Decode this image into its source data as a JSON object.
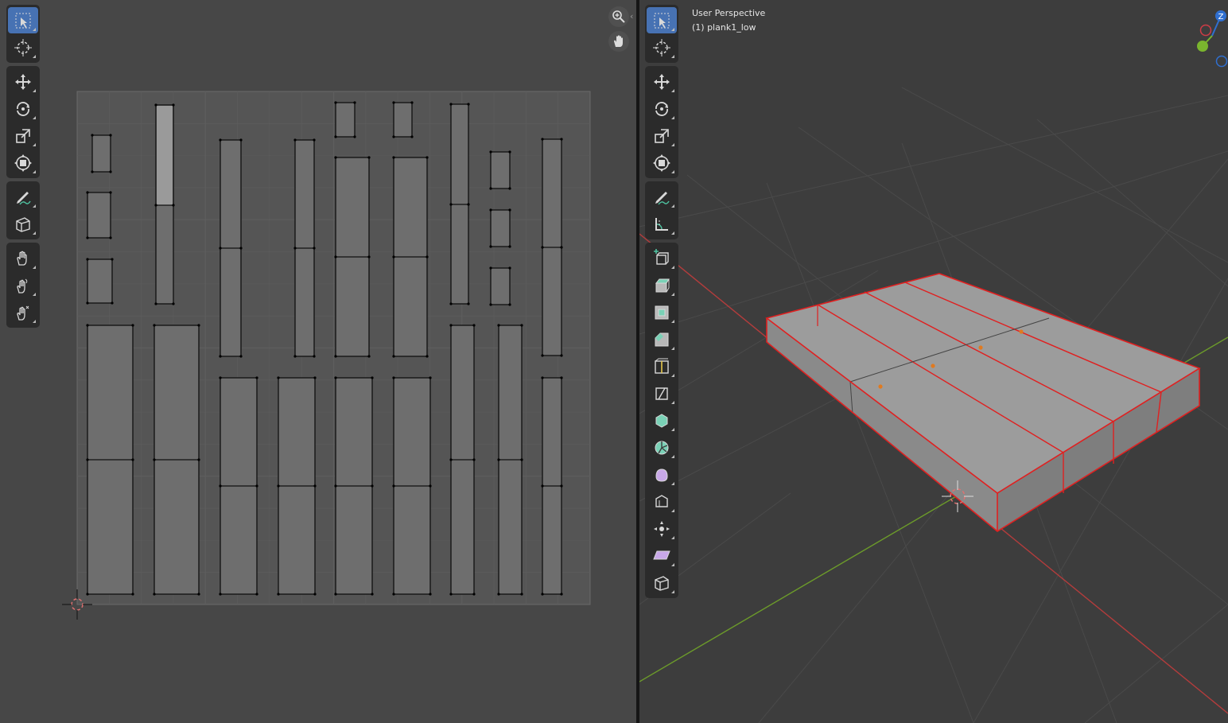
{
  "uv_editor": {
    "toolbar": [
      [
        {
          "name": "select-box-tool",
          "icon": "select-box-icon",
          "active": true
        },
        {
          "name": "cursor-tool",
          "icon": "cursor-icon",
          "active": false
        }
      ],
      [
        {
          "name": "move-tool",
          "icon": "move-icon",
          "active": false
        },
        {
          "name": "rotate-tool",
          "icon": "rotate-icon",
          "active": false
        },
        {
          "name": "scale-tool",
          "icon": "scale-icon",
          "active": false
        },
        {
          "name": "transform-tool",
          "icon": "transform-icon",
          "active": false
        }
      ],
      [
        {
          "name": "annotate-tool",
          "icon": "annotate-icon",
          "active": false
        },
        {
          "name": "rip-region-tool",
          "icon": "rip-region-icon",
          "active": false
        }
      ],
      [
        {
          "name": "grab-tool",
          "icon": "grab-hand-icon",
          "active": false
        },
        {
          "name": "relax-tool",
          "icon": "relax-icon",
          "active": false
        },
        {
          "name": "pinch-tool",
          "icon": "pinch-icon",
          "active": false
        }
      ]
    ],
    "nav_buttons": [
      {
        "name": "zoom-button",
        "icon": "zoom-icon"
      },
      {
        "name": "pan-button",
        "icon": "hand-icon"
      }
    ]
  },
  "viewport": {
    "view_name": "User Perspective",
    "object_label": "(1) plank1_low",
    "toolbar": [
      [
        {
          "name": "select-box-tool",
          "icon": "select-box-icon",
          "active": true
        },
        {
          "name": "cursor-tool",
          "icon": "cursor-icon",
          "active": false
        }
      ],
      [
        {
          "name": "move-tool",
          "icon": "move-icon",
          "active": false
        },
        {
          "name": "rotate-tool",
          "icon": "rotate-icon",
          "active": false
        },
        {
          "name": "scale-tool",
          "icon": "scale-icon",
          "active": false
        },
        {
          "name": "transform-tool",
          "icon": "transform-icon",
          "active": false
        }
      ],
      [
        {
          "name": "annotate-tool",
          "icon": "annotate-icon",
          "active": false
        },
        {
          "name": "measure-tool",
          "icon": "measure-icon",
          "active": false
        }
      ],
      [
        {
          "name": "add-cube-tool",
          "icon": "add-cube-icon",
          "active": false
        },
        {
          "name": "extrude-tool",
          "icon": "extrude-icon",
          "active": false
        },
        {
          "name": "inset-tool",
          "icon": "inset-icon",
          "active": false
        },
        {
          "name": "bevel-tool",
          "icon": "bevel-icon",
          "active": false
        },
        {
          "name": "loop-cut-tool",
          "icon": "loop-cut-icon",
          "active": false
        },
        {
          "name": "knife-tool",
          "icon": "knife-icon",
          "active": false
        },
        {
          "name": "poly-build-tool",
          "icon": "poly-build-icon",
          "active": false
        },
        {
          "name": "spin-tool",
          "icon": "spin-icon",
          "active": false
        },
        {
          "name": "smooth-tool",
          "icon": "smooth-icon",
          "active": false
        },
        {
          "name": "edge-slide-tool",
          "icon": "edge-slide-icon",
          "active": false
        },
        {
          "name": "shrink-fatten-tool",
          "icon": "shrink-fatten-icon",
          "active": false
        },
        {
          "name": "shear-tool",
          "icon": "shear-icon",
          "active": false
        },
        {
          "name": "rip-region-tool",
          "icon": "rip-region-icon",
          "active": false
        }
      ]
    ],
    "gizmo_axes": [
      {
        "label": "Z",
        "color": "#2f6fd0"
      },
      {
        "label": "",
        "color": "#d03c46"
      },
      {
        "label": "",
        "color": "#7ab52e"
      },
      {
        "label": "",
        "color": "#2f6fd0"
      }
    ]
  },
  "colors": {
    "active_tool": "#4772b3",
    "selection_edge": "#e02020",
    "x_axis": "#b43c3c",
    "y_axis": "#6c9b2a",
    "uv_face": "#6e6e6e",
    "uv_selected_face": "#9a9a9a"
  }
}
